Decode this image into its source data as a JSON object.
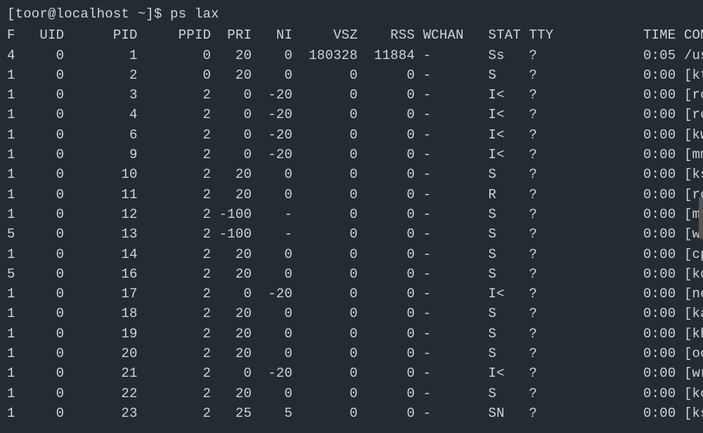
{
  "prompt": "[toor@localhost ~]$ ",
  "command": "ps lax",
  "headers": {
    "F": "F",
    "UID": "UID",
    "PID": "PID",
    "PPID": "PPID",
    "PRI": "PRI",
    "NI": "NI",
    "VSZ": "VSZ",
    "RSS": "RSS",
    "WCHAN": "WCHAN",
    "STAT": "STAT",
    "TTY": "TTY",
    "TIME": "TIME",
    "COMMAND": "COMMAND"
  },
  "rows": [
    {
      "F": "4",
      "UID": "0",
      "PID": "1",
      "PPID": "0",
      "PRI": "20",
      "NI": "0",
      "VSZ": "180328",
      "RSS": "11884",
      "WCHAN": "-",
      "STAT": "Ss",
      "TTY": "?",
      "TIME": "0:05",
      "COMMAND": "/usr/li"
    },
    {
      "F": "1",
      "UID": "0",
      "PID": "2",
      "PPID": "0",
      "PRI": "20",
      "NI": "0",
      "VSZ": "0",
      "RSS": "0",
      "WCHAN": "-",
      "STAT": "S",
      "TTY": "?",
      "TIME": "0:00",
      "COMMAND": "[kthrea"
    },
    {
      "F": "1",
      "UID": "0",
      "PID": "3",
      "PPID": "2",
      "PRI": "0",
      "NI": "-20",
      "VSZ": "0",
      "RSS": "0",
      "WCHAN": "-",
      "STAT": "I<",
      "TTY": "?",
      "TIME": "0:00",
      "COMMAND": "[rcu_gp"
    },
    {
      "F": "1",
      "UID": "0",
      "PID": "4",
      "PPID": "2",
      "PRI": "0",
      "NI": "-20",
      "VSZ": "0",
      "RSS": "0",
      "WCHAN": "-",
      "STAT": "I<",
      "TTY": "?",
      "TIME": "0:00",
      "COMMAND": "[rcu_pa"
    },
    {
      "F": "1",
      "UID": "0",
      "PID": "6",
      "PPID": "2",
      "PRI": "0",
      "NI": "-20",
      "VSZ": "0",
      "RSS": "0",
      "WCHAN": "-",
      "STAT": "I<",
      "TTY": "?",
      "TIME": "0:00",
      "COMMAND": "[kworke"
    },
    {
      "F": "1",
      "UID": "0",
      "PID": "9",
      "PPID": "2",
      "PRI": "0",
      "NI": "-20",
      "VSZ": "0",
      "RSS": "0",
      "WCHAN": "-",
      "STAT": "I<",
      "TTY": "?",
      "TIME": "0:00",
      "COMMAND": "[mm_per"
    },
    {
      "F": "1",
      "UID": "0",
      "PID": "10",
      "PPID": "2",
      "PRI": "20",
      "NI": "0",
      "VSZ": "0",
      "RSS": "0",
      "WCHAN": "-",
      "STAT": "S",
      "TTY": "?",
      "TIME": "0:00",
      "COMMAND": "[ksofti"
    },
    {
      "F": "1",
      "UID": "0",
      "PID": "11",
      "PPID": "2",
      "PRI": "20",
      "NI": "0",
      "VSZ": "0",
      "RSS": "0",
      "WCHAN": "-",
      "STAT": "R",
      "TTY": "?",
      "TIME": "0:00",
      "COMMAND": "[rcu_sc"
    },
    {
      "F": "1",
      "UID": "0",
      "PID": "12",
      "PPID": "2",
      "PRI": "-100",
      "NI": "-",
      "VSZ": "0",
      "RSS": "0",
      "WCHAN": "-",
      "STAT": "S",
      "TTY": "?",
      "TIME": "0:00",
      "COMMAND": "[migrat"
    },
    {
      "F": "5",
      "UID": "0",
      "PID": "13",
      "PPID": "2",
      "PRI": "-100",
      "NI": "-",
      "VSZ": "0",
      "RSS": "0",
      "WCHAN": "-",
      "STAT": "S",
      "TTY": "?",
      "TIME": "0:00",
      "COMMAND": "[watchd"
    },
    {
      "F": "1",
      "UID": "0",
      "PID": "14",
      "PPID": "2",
      "PRI": "20",
      "NI": "0",
      "VSZ": "0",
      "RSS": "0",
      "WCHAN": "-",
      "STAT": "S",
      "TTY": "?",
      "TIME": "0:00",
      "COMMAND": "[cpuhp/"
    },
    {
      "F": "5",
      "UID": "0",
      "PID": "16",
      "PPID": "2",
      "PRI": "20",
      "NI": "0",
      "VSZ": "0",
      "RSS": "0",
      "WCHAN": "-",
      "STAT": "S",
      "TTY": "?",
      "TIME": "0:00",
      "COMMAND": "[kdevtm"
    },
    {
      "F": "1",
      "UID": "0",
      "PID": "17",
      "PPID": "2",
      "PRI": "0",
      "NI": "-20",
      "VSZ": "0",
      "RSS": "0",
      "WCHAN": "-",
      "STAT": "I<",
      "TTY": "?",
      "TIME": "0:00",
      "COMMAND": "[netns]"
    },
    {
      "F": "1",
      "UID": "0",
      "PID": "18",
      "PPID": "2",
      "PRI": "20",
      "NI": "0",
      "VSZ": "0",
      "RSS": "0",
      "WCHAN": "-",
      "STAT": "S",
      "TTY": "?",
      "TIME": "0:00",
      "COMMAND": "[kaudit"
    },
    {
      "F": "1",
      "UID": "0",
      "PID": "19",
      "PPID": "2",
      "PRI": "20",
      "NI": "0",
      "VSZ": "0",
      "RSS": "0",
      "WCHAN": "-",
      "STAT": "S",
      "TTY": "?",
      "TIME": "0:00",
      "COMMAND": "[khungt"
    },
    {
      "F": "1",
      "UID": "0",
      "PID": "20",
      "PPID": "2",
      "PRI": "20",
      "NI": "0",
      "VSZ": "0",
      "RSS": "0",
      "WCHAN": "-",
      "STAT": "S",
      "TTY": "?",
      "TIME": "0:00",
      "COMMAND": "[oom_re"
    },
    {
      "F": "1",
      "UID": "0",
      "PID": "21",
      "PPID": "2",
      "PRI": "0",
      "NI": "-20",
      "VSZ": "0",
      "RSS": "0",
      "WCHAN": "-",
      "STAT": "I<",
      "TTY": "?",
      "TIME": "0:00",
      "COMMAND": "[writeb"
    },
    {
      "F": "1",
      "UID": "0",
      "PID": "22",
      "PPID": "2",
      "PRI": "20",
      "NI": "0",
      "VSZ": "0",
      "RSS": "0",
      "WCHAN": "-",
      "STAT": "S",
      "TTY": "?",
      "TIME": "0:00",
      "COMMAND": "[kcompa"
    },
    {
      "F": "1",
      "UID": "0",
      "PID": "23",
      "PPID": "2",
      "PRI": "25",
      "NI": "5",
      "VSZ": "0",
      "RSS": "0",
      "WCHAN": "-",
      "STAT": "SN",
      "TTY": "?",
      "TIME": "0:00",
      "COMMAND": "[ksmd]"
    }
  ]
}
